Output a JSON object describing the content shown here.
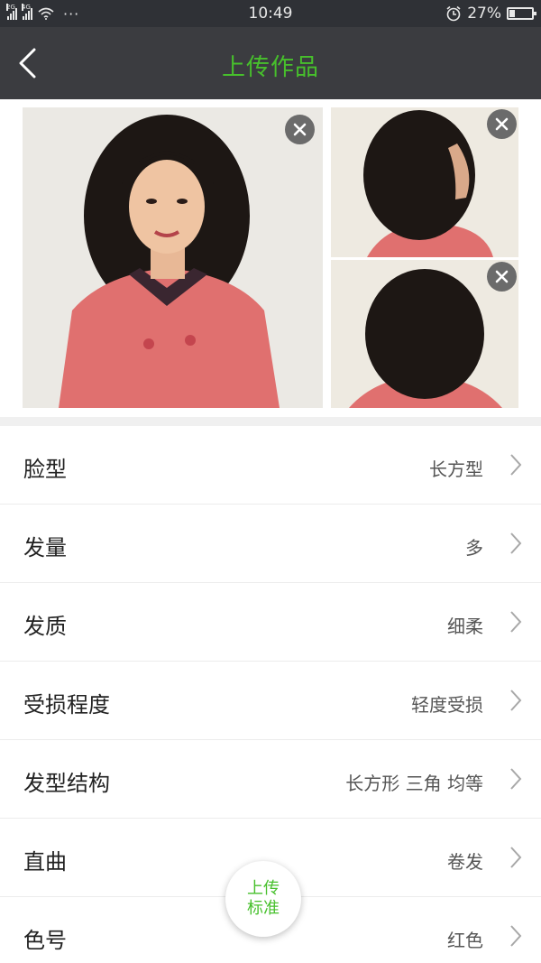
{
  "status_bar": {
    "network_1": "2G",
    "network_2": "4G",
    "more_dots": "···",
    "time": "10:49",
    "battery_percent": "27%",
    "battery_level": 0.27
  },
  "nav": {
    "title": "上传作品",
    "back_icon": "chevron-left-icon"
  },
  "photos": [
    {
      "name": "front",
      "delete_icon": "close-icon"
    },
    {
      "name": "side",
      "delete_icon": "close-icon"
    },
    {
      "name": "back",
      "delete_icon": "close-icon"
    }
  ],
  "attributes": [
    {
      "label": "脸型",
      "value": "长方型"
    },
    {
      "label": "发量",
      "value": "多"
    },
    {
      "label": "发质",
      "value": "细柔"
    },
    {
      "label": "受损程度",
      "value": "轻度受损"
    },
    {
      "label": "发型结构",
      "value": "长方形 三角 均等"
    },
    {
      "label": "直曲",
      "value": "卷发"
    },
    {
      "label": "色号",
      "value": "红色"
    }
  ],
  "upload_button": {
    "line1": "上传",
    "line2": "标准"
  },
  "colors": {
    "accent": "#47c02c",
    "nav_bg": "#3b3c40",
    "status_bg": "#2f3136"
  }
}
